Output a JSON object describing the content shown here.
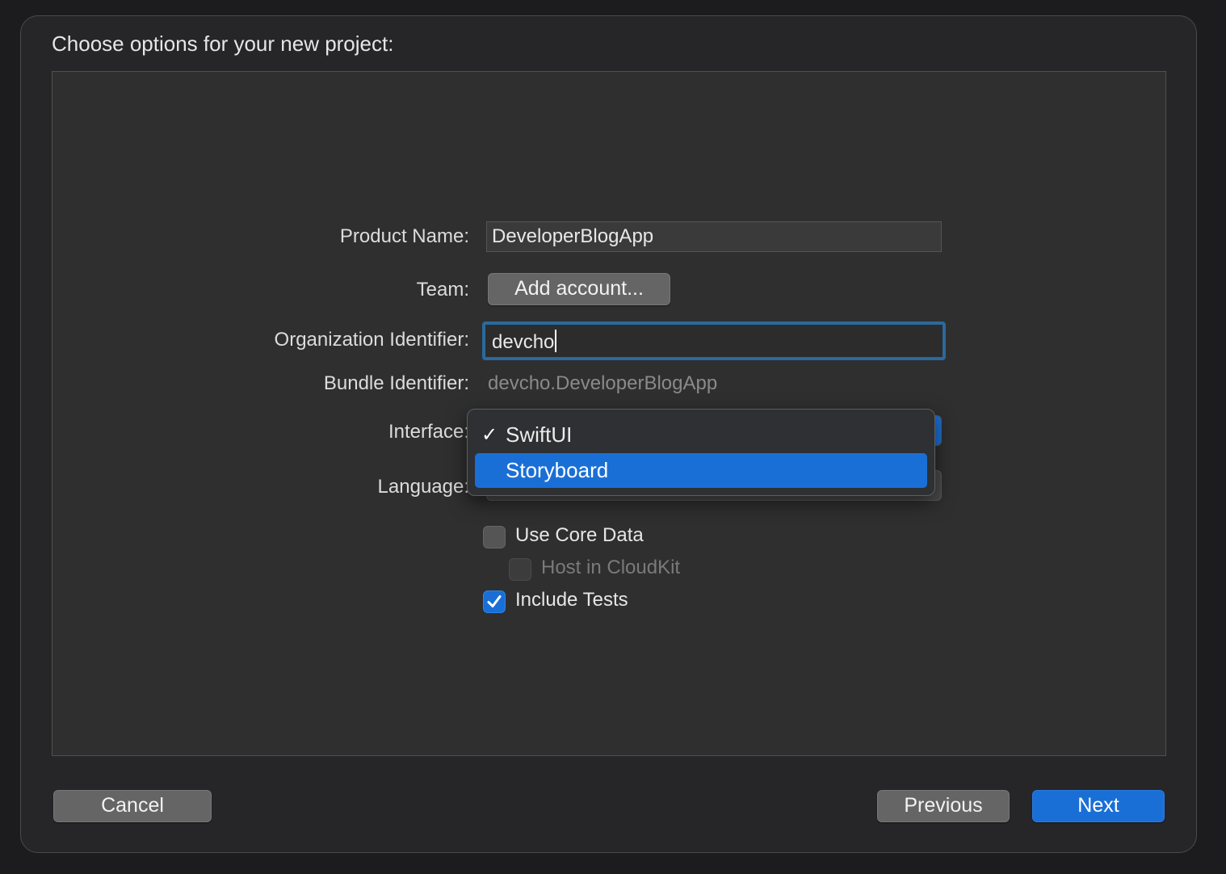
{
  "sheet": {
    "title": "Choose options for your new project:"
  },
  "form": {
    "product_name": {
      "label": "Product Name:",
      "value": "DeveloperBlogApp"
    },
    "team": {
      "label": "Team:",
      "button_label": "Add account..."
    },
    "organization_identifier": {
      "label": "Organization Identifier:",
      "value": "devcho"
    },
    "bundle_identifier": {
      "label": "Bundle Identifier:",
      "value": "devcho.DeveloperBlogApp"
    },
    "interface": {
      "label": "Interface:",
      "menu_open": true,
      "options": [
        {
          "label": "SwiftUI",
          "checked": true,
          "highlighted": false
        },
        {
          "label": "Storyboard",
          "checked": false,
          "highlighted": true
        }
      ]
    },
    "language": {
      "label": "Language:"
    },
    "checkboxes": [
      {
        "label": "Use Core Data",
        "checked": false,
        "enabled": true
      },
      {
        "label": "Host in CloudKit",
        "checked": false,
        "enabled": false
      },
      {
        "label": "Include Tests",
        "checked": true,
        "enabled": true
      }
    ]
  },
  "footer": {
    "cancel_label": "Cancel",
    "previous_label": "Previous",
    "next_label": "Next"
  },
  "colors": {
    "accent": "#1a6fd6",
    "focus_ring": "#2a6a9d",
    "background": "#262628",
    "panel": "#2f2f2f"
  },
  "icons": {
    "menu_checkmark": "checkmark-icon",
    "checkbox_checkmark": "checkmark-icon"
  }
}
